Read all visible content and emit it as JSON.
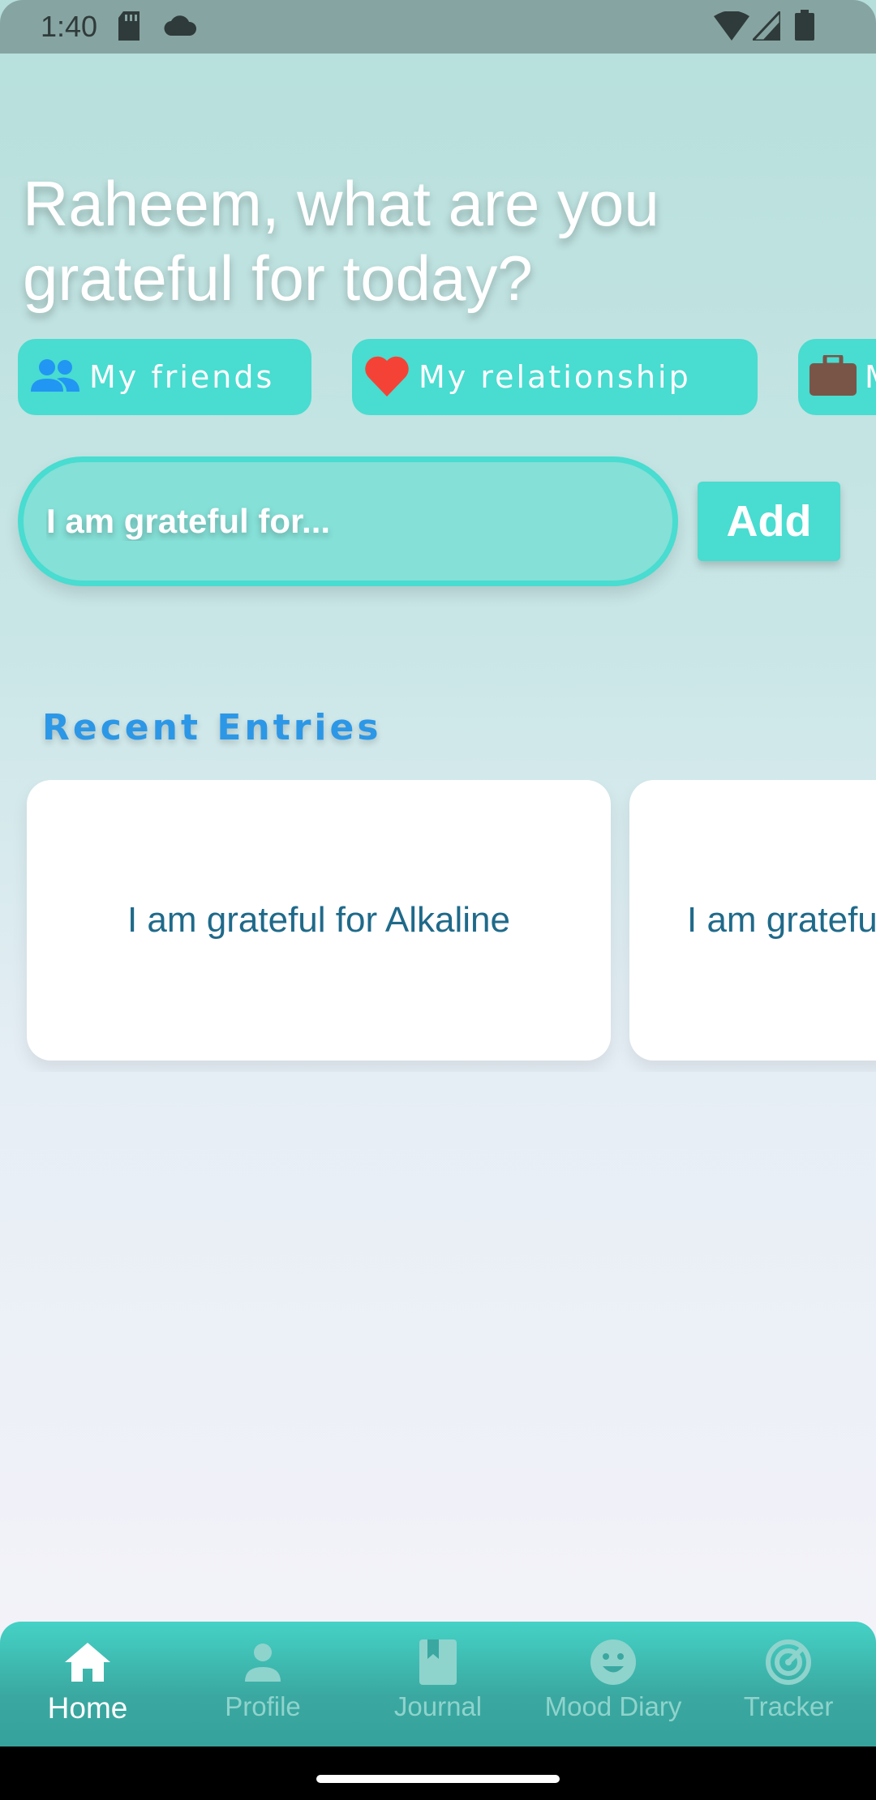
{
  "status_bar": {
    "time": "1:40",
    "icons": [
      "sd-card-icon",
      "cloud-icon",
      "wifi-icon",
      "signal-icon",
      "battery-icon"
    ]
  },
  "greeting": "Raheem, what are you grateful for today?",
  "chips": [
    {
      "label": "My friends",
      "icon": "people-icon",
      "icon_color": "#2196f3"
    },
    {
      "label": "My relationship",
      "icon": "heart-icon",
      "icon_color": "#f44336"
    },
    {
      "label": "M",
      "icon": "briefcase-icon",
      "icon_color": "#795548"
    }
  ],
  "entry": {
    "placeholder": "I am grateful for...",
    "add_label": "Add"
  },
  "recent": {
    "title": "Recent Entries",
    "entries": [
      "I am grateful for Alkaline",
      "I am gratefu"
    ]
  },
  "nav": {
    "items": [
      {
        "label": "Home",
        "icon": "home-icon",
        "active": true
      },
      {
        "label": "Profile",
        "icon": "person-icon",
        "active": false
      },
      {
        "label": "Journal",
        "icon": "book-icon",
        "active": false
      },
      {
        "label": "Mood Diary",
        "icon": "smiley-icon",
        "active": false
      },
      {
        "label": "Tracker",
        "icon": "track-changes-icon",
        "active": false
      }
    ]
  },
  "colors": {
    "accent": "#49dcd0",
    "section_title": "#2c97e6",
    "card_text": "#1f6a8a"
  }
}
